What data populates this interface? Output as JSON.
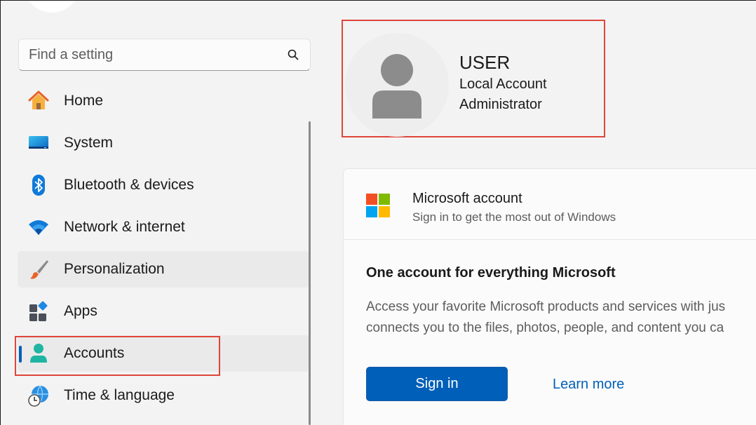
{
  "search": {
    "placeholder": "Find a setting"
  },
  "nav": {
    "items": [
      {
        "label": "Home",
        "icon": "home-icon"
      },
      {
        "label": "System",
        "icon": "monitor-icon"
      },
      {
        "label": "Bluetooth & devices",
        "icon": "bluetooth-icon"
      },
      {
        "label": "Network & internet",
        "icon": "wifi-icon"
      },
      {
        "label": "Personalization",
        "icon": "paintbrush-icon"
      },
      {
        "label": "Apps",
        "icon": "apps-icon"
      },
      {
        "label": "Accounts",
        "icon": "person-icon",
        "selected": true
      },
      {
        "label": "Time & language",
        "icon": "globe-clock-icon"
      }
    ]
  },
  "profile": {
    "name": "USER",
    "account_type": "Local Account",
    "role": "Administrator"
  },
  "ms_account": {
    "title": "Microsoft account",
    "subtitle": "Sign in to get the most out of Windows",
    "heading": "One account for everything Microsoft",
    "description_line1": "Access your favorite Microsoft products and services with jus",
    "description_line2": "connects you to the files, photos, people, and content you ca",
    "signin_label": "Sign in",
    "learn_more_label": "Learn more"
  },
  "colors": {
    "accent": "#005fb8",
    "highlight_box": "#e0453a"
  }
}
